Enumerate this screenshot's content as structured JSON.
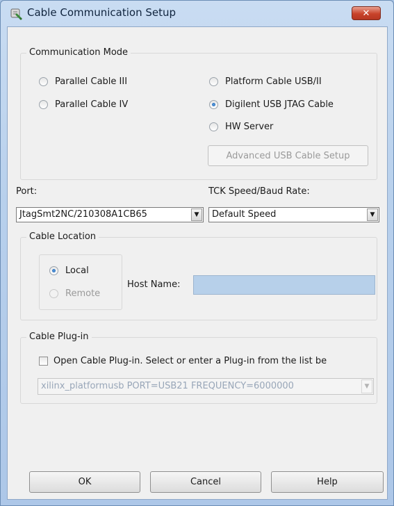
{
  "window": {
    "title": "Cable Communication Setup",
    "close_glyph": "✕",
    "app_icon": "cable-setup-icon"
  },
  "communication_mode": {
    "legend": "Communication Mode",
    "options": [
      {
        "label": "Parallel Cable III",
        "checked": false
      },
      {
        "label": "Parallel Cable IV",
        "checked": false
      },
      {
        "label": "Platform Cable USB/II",
        "checked": false
      },
      {
        "label": "Digilent USB JTAG Cable",
        "checked": true
      },
      {
        "label": "HW Server",
        "checked": false
      }
    ],
    "advanced_button": "Advanced USB Cable Setup"
  },
  "port": {
    "label": "Port:",
    "value": "JtagSmt2NC/210308A1CB65"
  },
  "speed": {
    "label": "TCK Speed/Baud Rate:",
    "value": "Default Speed"
  },
  "cable_location": {
    "legend": "Cable Location",
    "local_label": "Local",
    "remote_label": "Remote",
    "host_label": "Host Name:",
    "host_value": ""
  },
  "plugin": {
    "legend": "Cable Plug-in",
    "checkbox_label": "Open Cable Plug-in. Select or enter a Plug-in from the list be",
    "combo_value": "xilinx_platformusb PORT=USB21 FREQUENCY=6000000"
  },
  "buttons": {
    "ok": "OK",
    "cancel": "Cancel",
    "help": "Help"
  },
  "colors": {
    "titlebar": "#b8d0ec",
    "close": "#c8432b",
    "host_field": "#b7d0ea"
  }
}
